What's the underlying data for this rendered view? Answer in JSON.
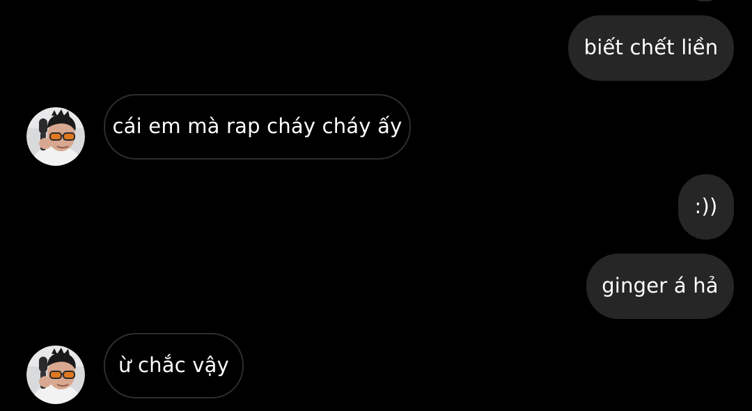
{
  "conversation": {
    "messages": [
      {
        "direction": "outgoing",
        "text": "biết chết liền"
      },
      {
        "direction": "incoming",
        "text": "cái em mà rap cháy cháy ấy"
      },
      {
        "direction": "outgoing",
        "text": ":))"
      },
      {
        "direction": "outgoing",
        "text": "ginger á hả"
      },
      {
        "direction": "incoming",
        "text": "ừ chắc vậy"
      }
    ]
  },
  "colors": {
    "background": "#000000",
    "outgoing_bubble": "#262626",
    "incoming_bubble_border": "#2e2e2e",
    "text": "#ffffff"
  },
  "icons": {
    "contact_avatar": "profile-photo-man-with-microphone-and-orange-sunglasses"
  }
}
